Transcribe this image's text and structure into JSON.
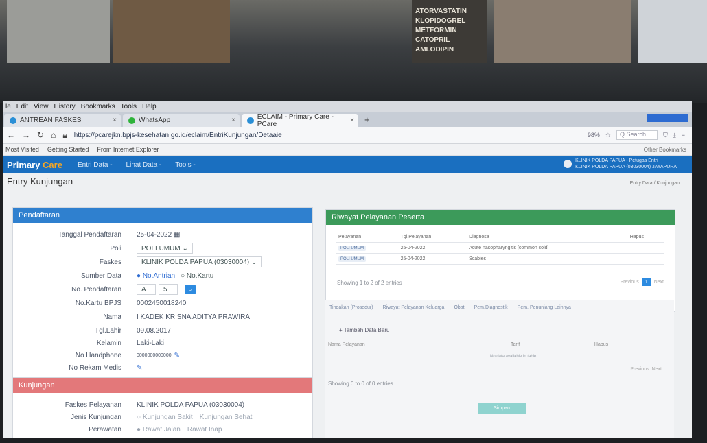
{
  "environment": {
    "shelf_labels": [
      "ATORVASTATIN",
      "KLOPIDOGREL",
      "METFORMIN",
      "CATOPRIL",
      "AMLODIPIN"
    ]
  },
  "browser": {
    "menu": [
      "le",
      "Edit",
      "View",
      "History",
      "Bookmarks",
      "Tools",
      "Help"
    ],
    "tabs": [
      {
        "label": "ANTREAN FASKES",
        "close": "×"
      },
      {
        "label": "WhatsApp",
        "close": "×"
      },
      {
        "label": "ECLAIM - Primary Care - PCare",
        "close": "×"
      }
    ],
    "new_tab": "+",
    "url": "https://pcarejkn.bpjs-kesehatan.go.id/eclaim/EntriKunjungan/Detaaie",
    "zoom": "98%",
    "search_placeholder": "Q Search",
    "bookmarks": [
      "Most Visited",
      "Getting Started",
      "From Internet Explorer"
    ],
    "other_bookmarks": "Other Bookmarks"
  },
  "app": {
    "brand_primary": "Primary",
    "brand_care": "Care",
    "menus": [
      "Entri Data -",
      "Lihat Data -",
      "Tools -"
    ],
    "user_line1": "KLINIK POLDA PAPUA - Petugas Entri",
    "user_line2": "KLINIK POLDA PAPUA (03030004) JAYAPURA",
    "page_title": "Entry Kunjungan",
    "breadcrumb": "Entry Data / Kunjungan"
  },
  "pendaftaran": {
    "title": "Pendaftaran",
    "fields": [
      {
        "label": "Tanggal Pendaftaran",
        "value": "25-04-2022"
      },
      {
        "label": "Poli",
        "value": "POLI UMUM"
      },
      {
        "label": "Faskes",
        "value": "KLINIK POLDA PAPUA (03030004)"
      },
      {
        "label": "Sumber Data",
        "value": "No.Antrian",
        "alt": "No.Kartu"
      },
      {
        "label": "No. Pendaftaran",
        "value": "A",
        "value2": "5"
      },
      {
        "label": "No.Kartu BPJS",
        "value": "0002450018240"
      },
      {
        "label": "Nama",
        "value": "I KADEK KRISNA ADITYA PRAWIRA"
      },
      {
        "label": "Tgl.Lahir",
        "value": "09.08.2017"
      },
      {
        "label": "Kelamin",
        "value": "Laki-Laki"
      },
      {
        "label": "No Handphone",
        "value": "0000000000000"
      },
      {
        "label": "No Rekam Medis",
        "value": ""
      }
    ]
  },
  "kunjungan": {
    "title": "Kunjungan",
    "fields": [
      {
        "label": "Faskes Pelayanan",
        "value": "KLINIK POLDA PAPUA (03030004)"
      },
      {
        "label": "Jenis Kunjungan",
        "value": "Kunjungan Sakit",
        "alt": "Kunjungan Sehat"
      },
      {
        "label": "Perawatan",
        "value": "Rawat Jalan",
        "alt": "Rawat Inap"
      }
    ]
  },
  "riwayat": {
    "title": "Riwayat Pelayanan Peserta",
    "columns": [
      "Pelayanan",
      "Tgl.Pelayanan",
      "Diagnosa",
      "Hapus"
    ],
    "rows": [
      {
        "pelayanan": "POLI UMUM",
        "tgl": "25-04-2022",
        "diagnosa": "Acute nasopharyngitis [common cold]"
      },
      {
        "pelayanan": "POLI UMUM",
        "tgl": "25-04-2022",
        "diagnosa": "Scabies"
      }
    ],
    "showing": "Showing 1 to 2 of 2 entries",
    "prev": "Previous",
    "page": "1",
    "next": "Next"
  },
  "tindakan": {
    "tabs": [
      "Tindakan (Prosedur)",
      "Riwayat Pelayanan Keluarga",
      "Obat",
      "Pem.Diagnostik",
      "Pem. Penunjang Lainnya"
    ],
    "add_label": "+ Tambah Data Baru",
    "col1": "Nama Pelayanan",
    "col2": "Tarif",
    "col3": "Hapus",
    "empty": "No data available in table",
    "showing": "Showing 0 to 0 of 0 entries",
    "prev": "Previous",
    "next": "Next",
    "save": "Simpan"
  }
}
